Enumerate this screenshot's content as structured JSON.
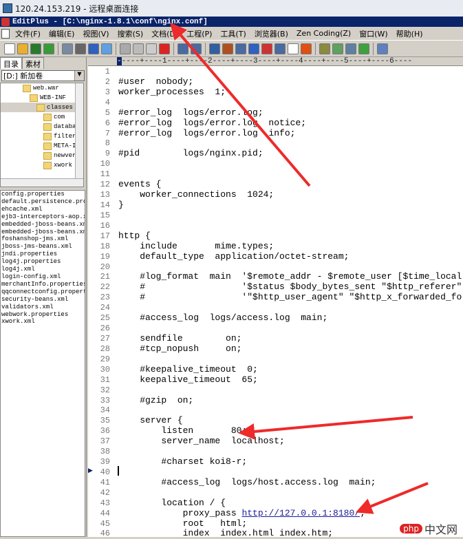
{
  "remote_title": "120.24.153.219 - 远程桌面连接",
  "app_title": "EditPlus - [C:\\nginx-1.8.1\\conf\\nginx.conf]",
  "menu": [
    "文件(F)",
    "编辑(E)",
    "视图(V)",
    "搜索(S)",
    "文档(D)",
    "工程(P)",
    "工具(T)",
    "浏览器(B)",
    "Zen Coding(Z)",
    "窗口(W)",
    "帮助(H)"
  ],
  "left_tabs": [
    "目录",
    "素材"
  ],
  "drive": "[D:] 新加卷",
  "tree": [
    {
      "name": "web.war",
      "indent": 1
    },
    {
      "name": "WEB-INF",
      "indent": 2
    },
    {
      "name": "classes",
      "indent": 3,
      "selected": true
    },
    {
      "name": "com",
      "indent": 4
    },
    {
      "name": "database",
      "indent": 4
    },
    {
      "name": "filters",
      "indent": 4
    },
    {
      "name": "META-INF",
      "indent": 4
    },
    {
      "name": "newver",
      "indent": 4
    },
    {
      "name": "xwork",
      "indent": 4
    }
  ],
  "files": [
    "config.properties",
    "default.persistence.pro",
    "ehcache.xml",
    "ejb3-interceptors-aop.x",
    "embedded-jboss-beans.xm",
    "embedded-jboss-beans.xm",
    "foshanshop-jms.xml",
    "jboss-jms-beans.xml",
    "jndi.properties",
    "log4j.properties",
    "log4j.xml",
    "login-config.xml",
    "merchantInfo.properties",
    "qqconnectconfig.propert",
    "security-beans.xml",
    "validators.xml",
    "webwork.properties",
    "xwork.xml"
  ],
  "ruler": "----+----1----+----2----+----3----+----4----+----5----+----6----",
  "code": [
    "",
    "#user  nobody;",
    "worker_processes  1;",
    "",
    "#error_log  logs/error.log;",
    "#error_log  logs/error.log  notice;",
    "#error_log  logs/error.log  info;",
    "",
    "#pid        logs/nginx.pid;",
    "",
    "",
    "events {",
    "    worker_connections  1024;",
    "}",
    "",
    "",
    "http {",
    "    include       mime.types;",
    "    default_type  application/octet-stream;",
    "",
    "    #log_format  main  '$remote_addr - $remote_user [$time_local",
    "    #                  '$status $body_bytes_sent \"$http_referer\"",
    "    #                  '\"$http_user_agent\" \"$http_x_forwarded_fo",
    "",
    "    #access_log  logs/access.log  main;",
    "",
    "    sendfile        on;",
    "    #tcp_nopush     on;",
    "",
    "    #keepalive_timeout  0;",
    "    keepalive_timeout  65;",
    "",
    "    #gzip  on;",
    "",
    "    server {",
    "        listen       80;",
    "        server_name  localhost;",
    "",
    "        #charset koi8-r;",
    "",
    "        #access_log  logs/host.access.log  main;",
    "",
    "        location / {",
    "            proxy_pass ",
    "            root   html;",
    "            index  index.html index.htm;"
  ],
  "proxy_url": "http://127.0.0.1:8180/",
  "proxy_tail": ";",
  "watermark": {
    "badge": "php",
    "text": "中文网"
  }
}
